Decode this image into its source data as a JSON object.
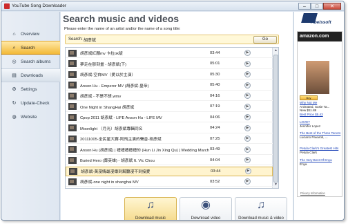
{
  "window": {
    "title": "YouTube Song Downloader",
    "minimize": "–",
    "maximize": "□",
    "close": "✕"
  },
  "sidebar": {
    "items": [
      {
        "label": "Overview",
        "icon": "home-icon",
        "glyph": "⌂"
      },
      {
        "label": "Search",
        "icon": "search-icon",
        "glyph": "⌕"
      },
      {
        "label": "Search albums",
        "icon": "search-albums-icon",
        "glyph": "◎"
      },
      {
        "label": "Downloads",
        "icon": "downloads-icon",
        "glyph": "▤"
      },
      {
        "label": "Settings",
        "icon": "gear-icon",
        "glyph": "⚙"
      },
      {
        "label": "Update-Check",
        "icon": "refresh-icon",
        "glyph": "↻"
      },
      {
        "label": "Website",
        "icon": "globe-icon",
        "glyph": "◍"
      }
    ]
  },
  "main": {
    "title": "Search music and videos",
    "instruction": "Please enter the name of an artist and/or the name of a song title:",
    "search": {
      "label": "Search:",
      "value": "胡彥斌",
      "go": "Go"
    },
    "results": [
      {
        "title": "胡彥斌紅顏mv 卡拉ok版",
        "duration": "03:44"
      },
      {
        "title": "夢走在那刻畫 - 胡彥斌(下)",
        "duration": "05:01"
      },
      {
        "title": "胡彥斌-空白MV（愛以於主演）",
        "duration": "05:30"
      },
      {
        "title": "Anson Hu - Emperor MV (胡彥斌-皇帝)",
        "duration": "05:40"
      },
      {
        "title": "胡彥斌 - 不是不想.wmv",
        "duration": "04:16"
      },
      {
        "title": "One Night in ShangHai 胡彥斌",
        "duration": "07:19"
      },
      {
        "title": "Cpop 2011 胡彥斌 - LIFE Anson Hu - LIFE MV",
        "duration": "04:06"
      },
      {
        "title": "Moonlight （月光）胡彥斌專輯同名",
        "duration": "04:24"
      },
      {
        "title": "20111005-全民星大賽-阿飛主演的聲音-胡彥斌",
        "duration": "07:25"
      },
      {
        "title": "Anson Hu (胡彥斌) | 禮禮禮禮禮的 (Hun Li Jin Xing Qu) | Wedding March [Kara - S",
        "duration": "03:49"
      },
      {
        "title": "Buried Hero (葬英雄) - 胡彥斌 ft. Vic Chou",
        "duration": "04:04"
      },
      {
        "title": "胡彥斌-黃漫情最漫傳到幫聽漫不到接愛",
        "duration": "03:44"
      },
      {
        "title": "胡彥斌-one night in shanghai MV",
        "duration": "03:52"
      }
    ],
    "selected_index": 11,
    "actions": [
      {
        "label": "Download music",
        "icon": "music-note-icon",
        "glyph": "♫"
      },
      {
        "label": "Download video",
        "icon": "film-reel-icon",
        "glyph": "◉"
      },
      {
        "label": "Download music & video",
        "icon": "music-video-icon",
        "glyph": "♫"
      }
    ]
  },
  "right_panel": {
    "logo": "Abelssoft",
    "ad": {
      "brand": "amazon.com",
      "tagline": "Privacy Information",
      "buy": "Buy",
      "item1_title": "Why Not Me",
      "item1_artist": "Animated, Susie Ta...",
      "item1_price": "New $11.88",
      "item1_link2": "Best Price $5.43",
      "item2_title": "LOVE?",
      "item2_artist": "Jennifer Lopez",
      "item3_title": "The Best of the Three Tenors",
      "item3_artist": "Luciano Pavaroti, ...",
      "item4_title": "Petula Clark's Greatest Hits",
      "item4_artist": "Petula Clark",
      "item5_title": "The Very Best Of Enya",
      "item5_artist": "Enya"
    }
  }
}
